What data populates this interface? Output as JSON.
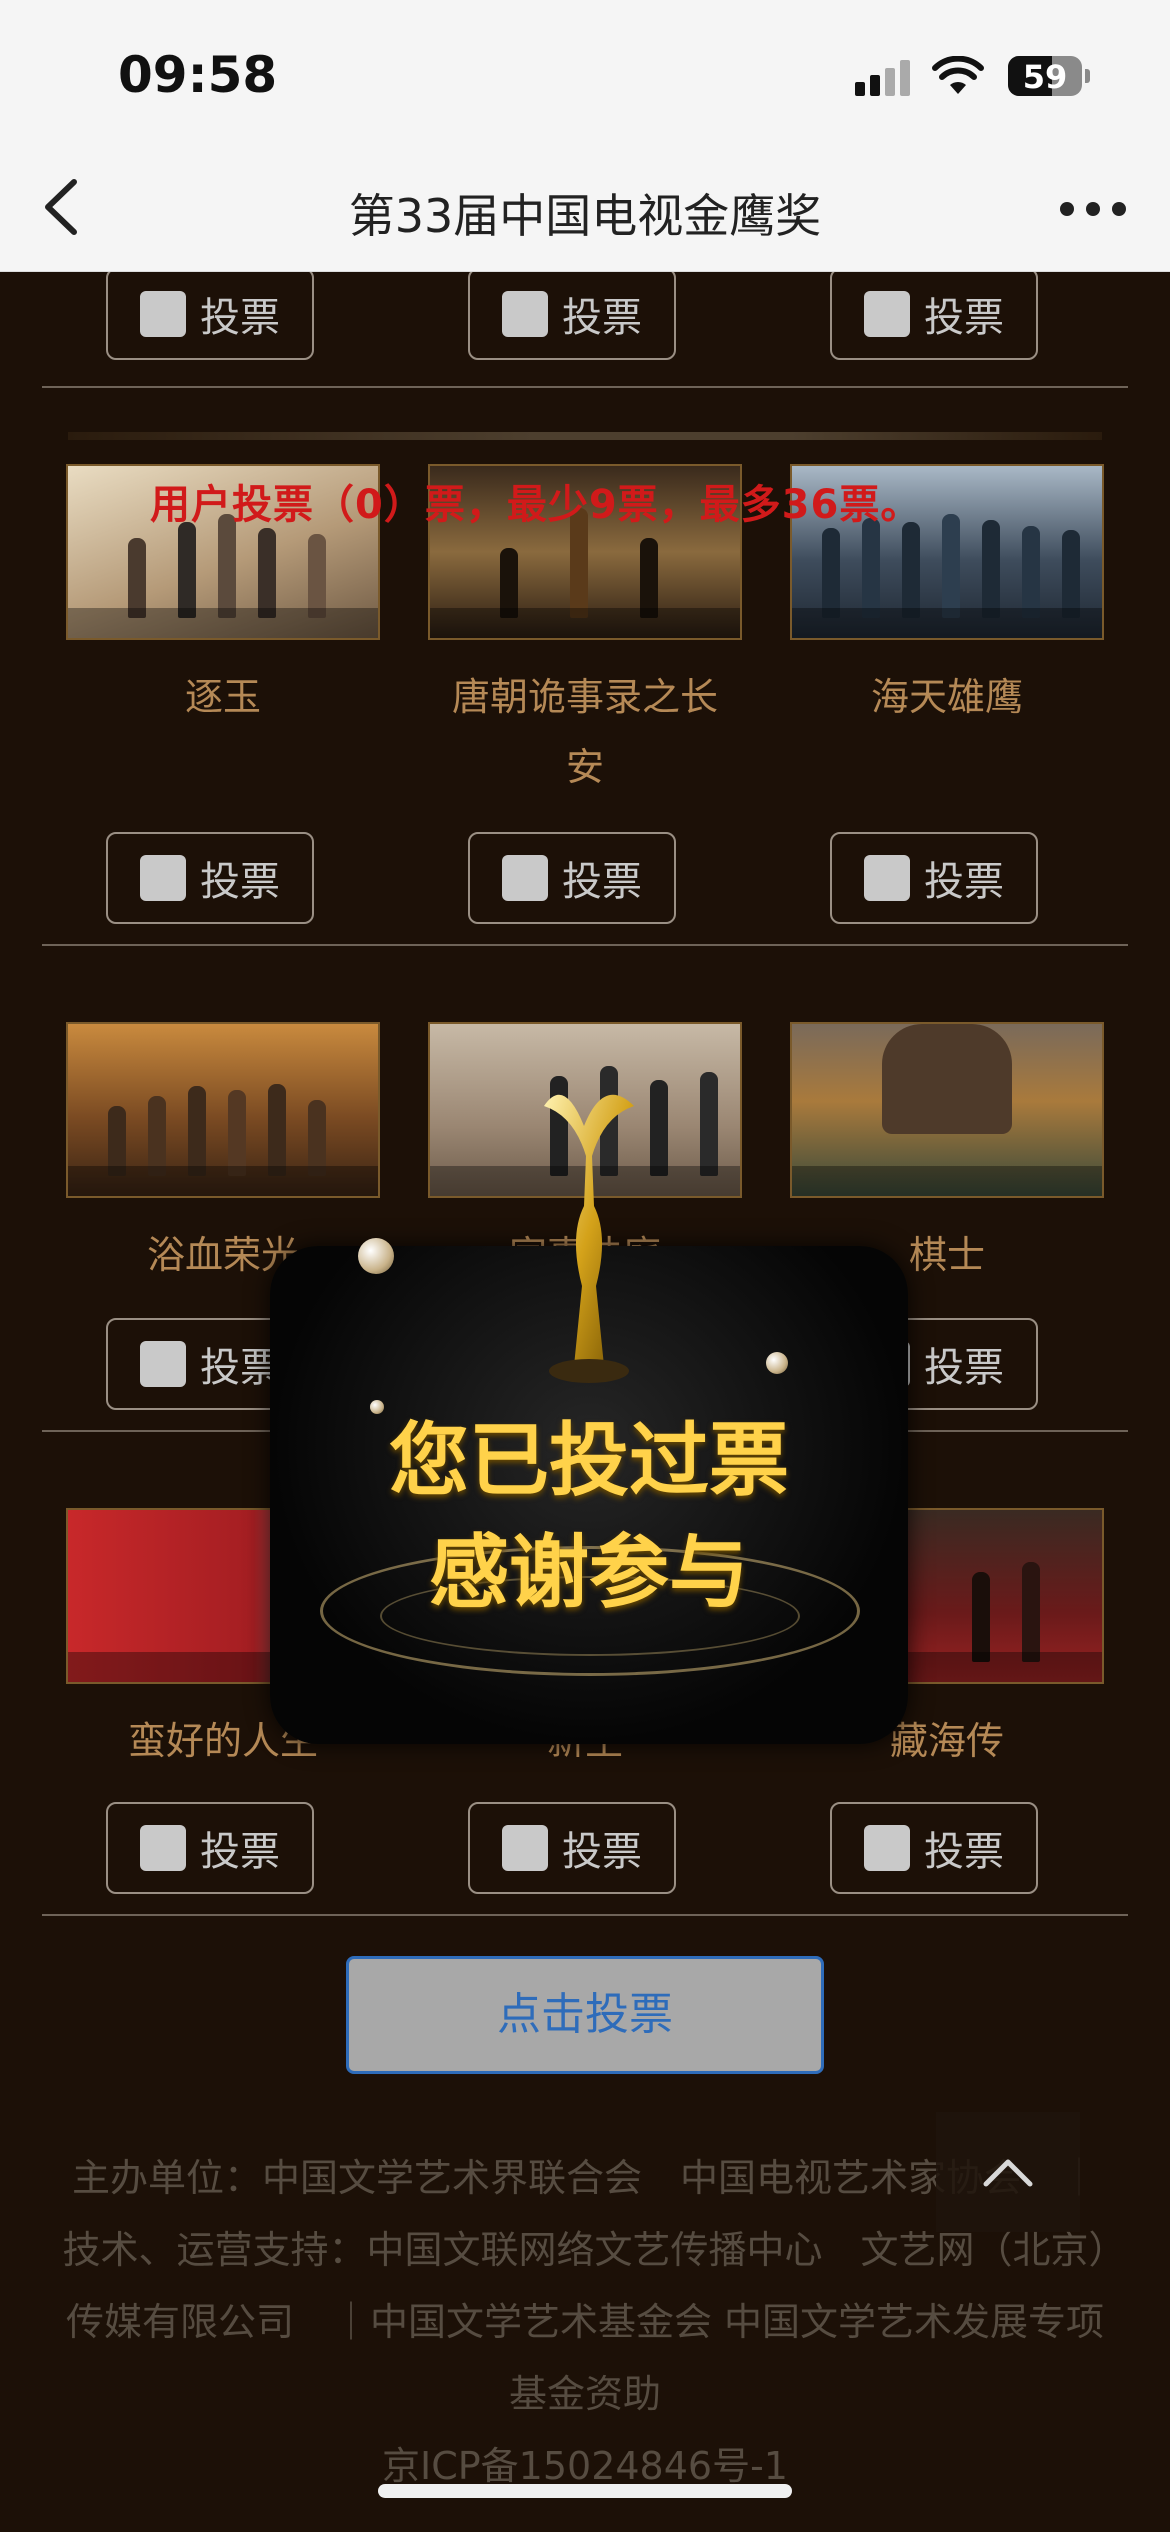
{
  "status": {
    "time": "09:58",
    "battery": "59"
  },
  "nav": {
    "title": "第33届中国电视金鹰奖"
  },
  "notice": "用户投票（0）票，最少9票，最多36票。",
  "vote_label": "投票",
  "rows": [
    {
      "items": [
        {
          "name": "逐玉"
        },
        {
          "name": "唐朝诡事录之长安"
        },
        {
          "name": "海天雄鹰"
        }
      ]
    },
    {
      "items": [
        {
          "name": "浴血荣光"
        },
        {
          "name": "家事法庭"
        },
        {
          "name": "棋士"
        }
      ]
    },
    {
      "items": [
        {
          "name": "蛮好的人生"
        },
        {
          "name": "新生"
        },
        {
          "name": "藏海传"
        }
      ]
    }
  ],
  "submit_label": "点击投票",
  "footer": {
    "line1": "主办单位：中国文学艺术界联合会　中国电视艺术家协会　｜技术、运营支持：中国文联网络文艺传播中心　文艺网（北京）传媒有限公司　｜中国文学艺术基金会 中国文学艺术发展专项基金资助",
    "icp": "京ICP备15024846号-1"
  },
  "modal": {
    "line1": "您已投过票",
    "line2": "感谢参与"
  },
  "colors": {
    "background": "#1c1007",
    "gold": "#b58956",
    "notice_red": "#d11a1a",
    "modal_text": "#ffd24a",
    "submit_border": "#2e6cba"
  },
  "icons": {
    "back": "chevron-left-icon",
    "more": "more-dots-icon",
    "back_top": "chevron-up-icon"
  }
}
